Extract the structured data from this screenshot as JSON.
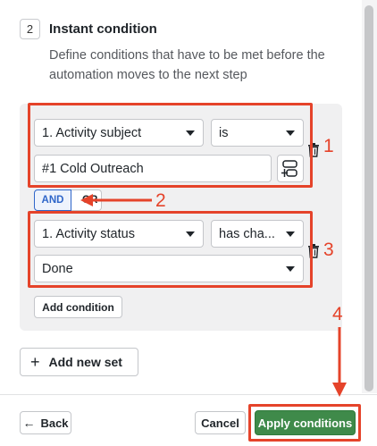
{
  "step": {
    "number": "2",
    "title": "Instant condition",
    "description": "Define conditions that have to be met before the automation moves to the next step"
  },
  "conditions": [
    {
      "field": "1. Activity subject",
      "operator": "is",
      "value": "#1 Cold Outreach"
    },
    {
      "field": "1. Activity status",
      "operator": "has cha...",
      "value": "Done"
    }
  ],
  "logic": {
    "and_label": "AND",
    "or_label": "OR",
    "selected": "AND"
  },
  "buttons": {
    "add_condition": "Add condition",
    "add_new_set_plus": "+",
    "add_new_set": "Add new set",
    "back_arrow": "←",
    "back": "Back",
    "cancel": "Cancel",
    "apply": "Apply conditions"
  },
  "annotations": [
    "1",
    "2",
    "3",
    "4"
  ],
  "colors": {
    "annotation_red": "#e5432a",
    "primary_green": "#3f8a4a",
    "and_blue": "#2f66c9"
  },
  "icons": {
    "field_insert": "insert-field-icon",
    "delete": "trash-icon"
  }
}
